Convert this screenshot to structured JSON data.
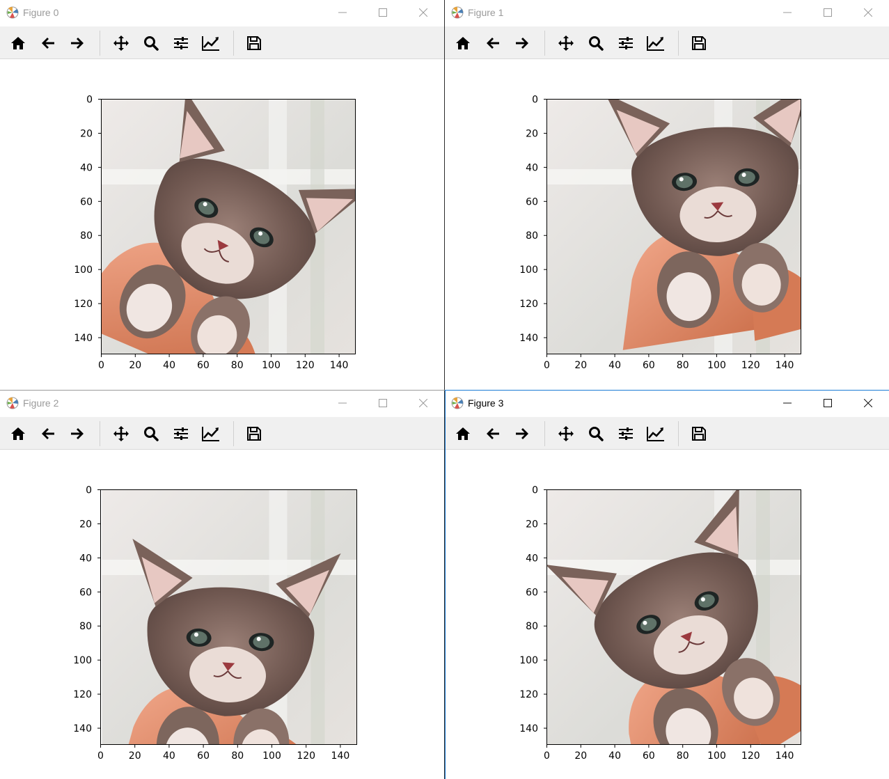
{
  "windows": [
    {
      "title": "Figure 0",
      "active": false
    },
    {
      "title": "Figure 1",
      "active": false
    },
    {
      "title": "Figure 2",
      "active": false
    },
    {
      "title": "Figure 3",
      "active": true
    }
  ],
  "toolbar_icons": [
    "home-icon",
    "back-arrow-icon",
    "forward-arrow-icon",
    "pan-icon",
    "zoom-icon",
    "configure-subplots-icon",
    "edit-axis-icon",
    "save-icon"
  ],
  "axes": {
    "x_ticks": [
      "0",
      "20",
      "40",
      "60",
      "80",
      "100",
      "120",
      "140"
    ],
    "y_ticks": [
      "0",
      "20",
      "40",
      "60",
      "80",
      "100",
      "120",
      "140"
    ]
  },
  "colors": {
    "toolbar_bg": "#f0f0f0",
    "active_border": "#1a7ad4",
    "inactive_title": "#9a9a9a"
  }
}
